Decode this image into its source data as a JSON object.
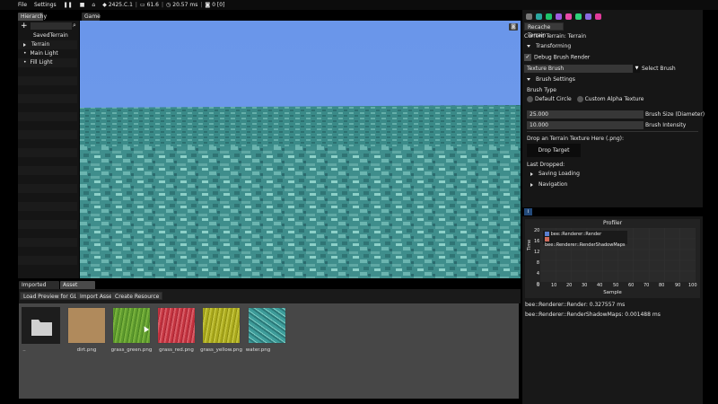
{
  "menubar": {
    "file": "File",
    "settings": "Settings",
    "build": "2425.C.1",
    "fps": "61.6",
    "frametime": "20.57 ms",
    "screenshots": "0 [0]"
  },
  "hierarchy": {
    "tab": "Hierarchy",
    "items": [
      "SavedTerrain",
      "Terrain",
      "Main Light",
      "Fill Light"
    ]
  },
  "game": {
    "tab": "Game",
    "sky_color": "#6a96ea",
    "water_color": "#3a8a8a"
  },
  "inspector": {
    "recache_button": "Recache Terrain",
    "current_terrain": "Current Terrain: Terrain",
    "transforming": "Transforming",
    "debug_brush": "Debug Brush Render",
    "texture_brush_field": "Texture Brush",
    "select_brush": "Select Brush",
    "brush_settings": "Brush Settings",
    "brush_type": "Brush Type",
    "default_circle": "Default Circle",
    "custom_alpha": "Custom Alpha Texture",
    "brush_size_value": "25.000",
    "brush_size_label": "Brush Size (Diameter)",
    "brush_intensity_value": "10.000",
    "brush_intensity_label": "Brush Intensity",
    "drop_prompt": "Drop an Terrain Texture Here (.png):",
    "drop_target": "Drop Target",
    "last_dropped": "Last Dropped:",
    "saving_loading": "Saving Loading",
    "navigation": "Navigation"
  },
  "profiler": {
    "title": "Profiler",
    "legend": [
      "bee::Renderer::Render",
      "bee::Renderer::RenderShadowMaps"
    ],
    "legend_colors": [
      "#5a7fd0",
      "#d06a5a"
    ],
    "ylabel": "Time",
    "xlabel": "Sample",
    "yticks": [
      "20",
      "16",
      "12",
      "8",
      "4",
      "0"
    ],
    "xticks": [
      "0",
      "10",
      "20",
      "30",
      "40",
      "50",
      "60",
      "70",
      "80",
      "90",
      "100"
    ],
    "stat1": "bee::Renderer::Render: 0.327557 ms",
    "stat2": "bee::Renderer::RenderShadowMaps: 0.001488 ms"
  },
  "assets": {
    "tabs": [
      "Imported Assets",
      "Asset Browser"
    ],
    "buttons": [
      "Load Preview for GLTFs",
      "Import Asset",
      "Create Resource"
    ],
    "folder_label": "..",
    "files": [
      {
        "name": "dirt.png",
        "color": "#b08a5c"
      },
      {
        "name": "grass_green.png",
        "color": "#5e9a2e"
      },
      {
        "name": "grass_red.png",
        "color": "#c4333f"
      },
      {
        "name": "grass_yellow.png",
        "color": "#a9a81c"
      },
      {
        "name": "water.png",
        "color": "#3e9c9a"
      }
    ]
  }
}
